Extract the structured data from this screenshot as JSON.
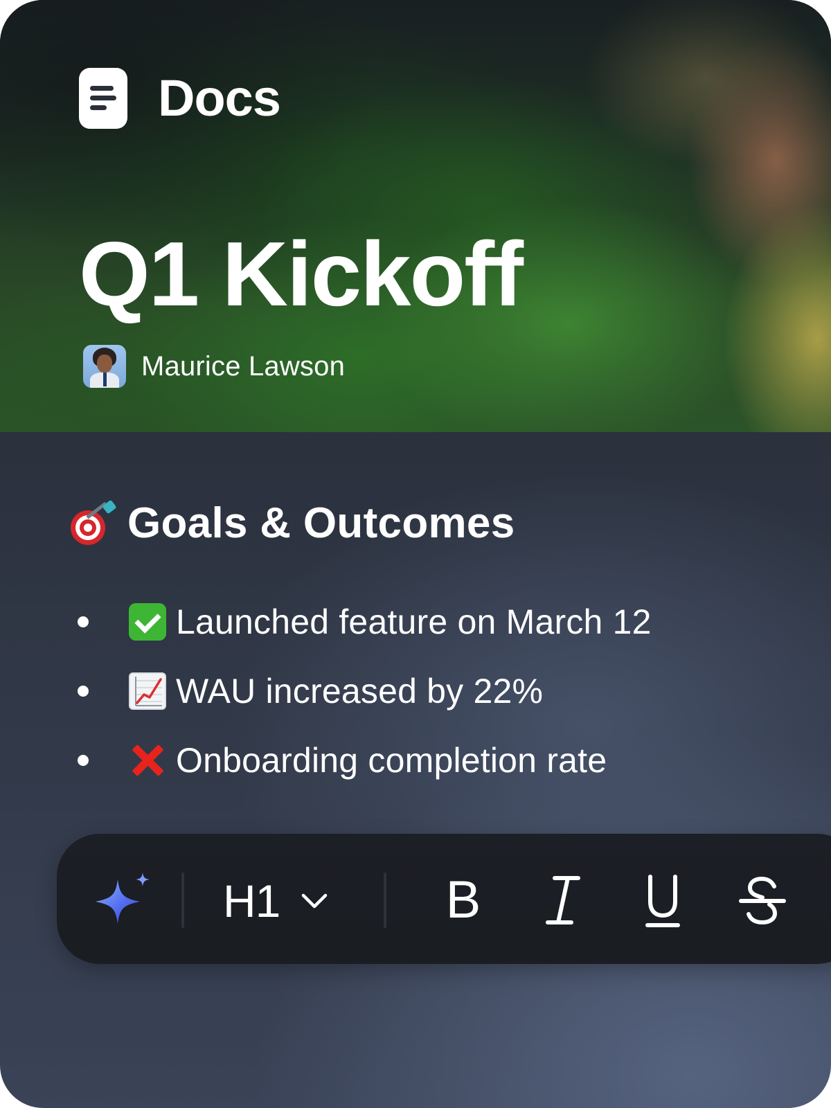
{
  "app": {
    "name": "Docs",
    "icon": "document-icon"
  },
  "document": {
    "title": "Q1 Kickoff",
    "author": {
      "name": "Maurice Lawson",
      "avatar": "avatar-photo"
    }
  },
  "section": {
    "icon": "direct-hit-dart-icon",
    "heading": "Goals & Outcomes",
    "items": [
      {
        "status_icon": "check-mark-button-icon",
        "text": "Launched feature on March 12"
      },
      {
        "status_icon": "chart-increasing-icon",
        "text": "WAU increased by 22%"
      },
      {
        "status_icon": "cross-mark-icon",
        "text": "Onboarding completion rate"
      }
    ]
  },
  "toolbar": {
    "ai_icon": "sparkles-icon",
    "heading_select": {
      "value": "H1",
      "icon": "chevron-down-icon"
    },
    "format_buttons": [
      {
        "label": "B",
        "icon": "bold-icon"
      },
      {
        "label": "I",
        "icon": "italic-icon"
      },
      {
        "label": "U",
        "icon": "underline-icon"
      },
      {
        "label": "S",
        "icon": "strikethrough-icon"
      }
    ]
  },
  "colors": {
    "text": "#ffffff",
    "toolbar_bg": "#1c1f25",
    "card_bg_bottom": "#3a4357",
    "ai_accent": "#4f6ff0",
    "check_green": "#3fb536",
    "cross_red": "#e8231c"
  }
}
